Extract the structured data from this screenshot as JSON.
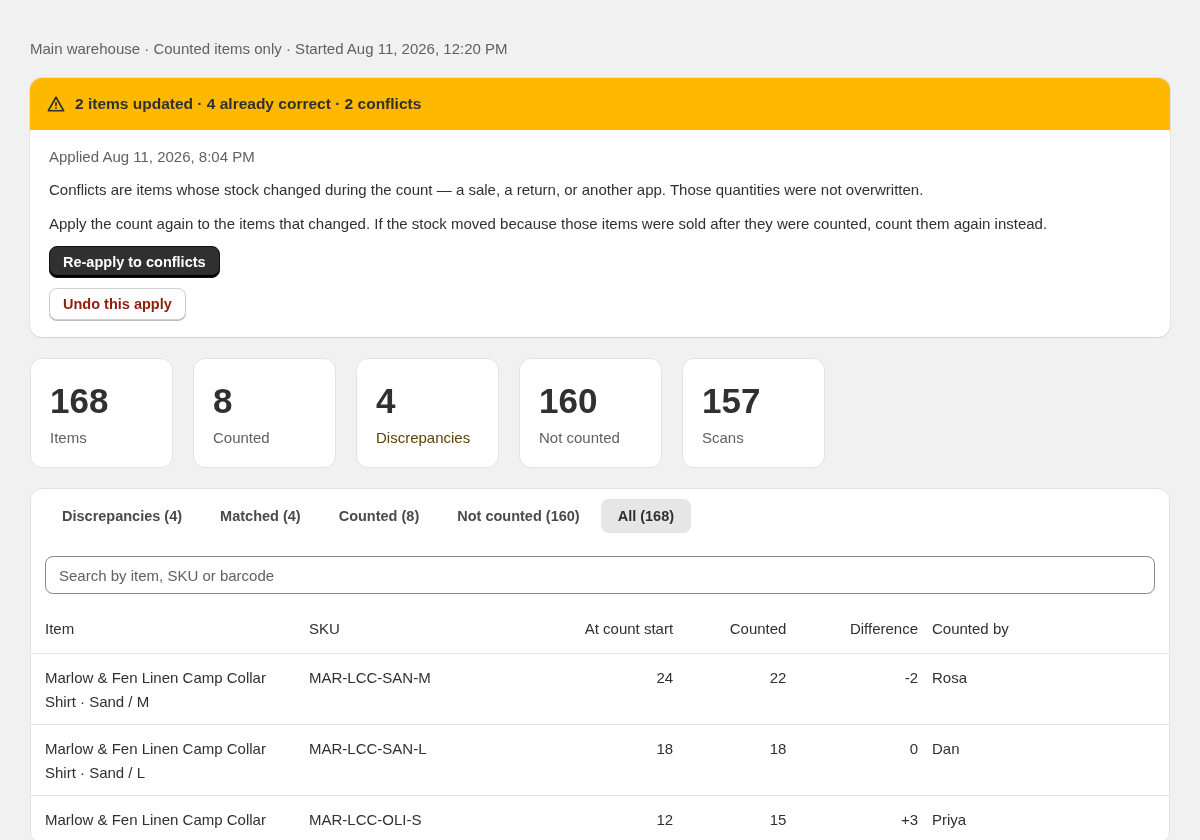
{
  "meta": "Main warehouse · Counted items only · Started Aug 11, 2026, 12:20 PM",
  "banner": {
    "kind": "warning",
    "title": "2 items updated · 4 already correct · 2 conflicts",
    "applied": "Applied Aug 11, 2026, 8:04 PM",
    "paragraphs": [
      "Conflicts are items whose stock changed during the count — a sale, a return, or another app. Those quantities were not overwritten.",
      "Apply the count again to the items that changed. If the stock moved because those items were sold after they were counted, count them again instead."
    ],
    "actions": [
      {
        "label": "Re-apply to conflicts",
        "kind": "primary"
      },
      {
        "label": "Undo this apply",
        "kind": "destructive"
      }
    ]
  },
  "stats": [
    {
      "value": "168",
      "label": "Items",
      "highlight": false
    },
    {
      "value": "8",
      "label": "Counted",
      "highlight": false
    },
    {
      "value": "4",
      "label": "Discrepancies",
      "highlight": true
    },
    {
      "value": "160",
      "label": "Not counted",
      "highlight": false
    },
    {
      "value": "157",
      "label": "Scans",
      "highlight": false
    }
  ],
  "tabs": [
    {
      "label": "Discrepancies (4)",
      "selected": false
    },
    {
      "label": "Matched (4)",
      "selected": false
    },
    {
      "label": "Counted (8)",
      "selected": false
    },
    {
      "label": "Not counted (160)",
      "selected": false
    },
    {
      "label": "All (168)",
      "selected": true
    }
  ],
  "search": {
    "placeholder": "Search by item, SKU or barcode"
  },
  "table": {
    "columns": [
      "Item",
      "SKU",
      "At count start",
      "Counted",
      "Difference",
      "Counted by"
    ],
    "rows": [
      [
        "Marlow & Fen Linen Camp Collar Shirt · Sand / M",
        "MAR-LCC-SAN-M",
        "24",
        "22",
        "-2",
        "Rosa"
      ],
      [
        "Marlow & Fen Linen Camp Collar Shirt · Sand / L",
        "MAR-LCC-SAN-L",
        "18",
        "18",
        "0",
        "Dan"
      ],
      [
        "Marlow & Fen Linen Camp Collar",
        "MAR-LCC-OLI-S",
        "12",
        "15",
        "+3",
        "Priya"
      ]
    ]
  }
}
